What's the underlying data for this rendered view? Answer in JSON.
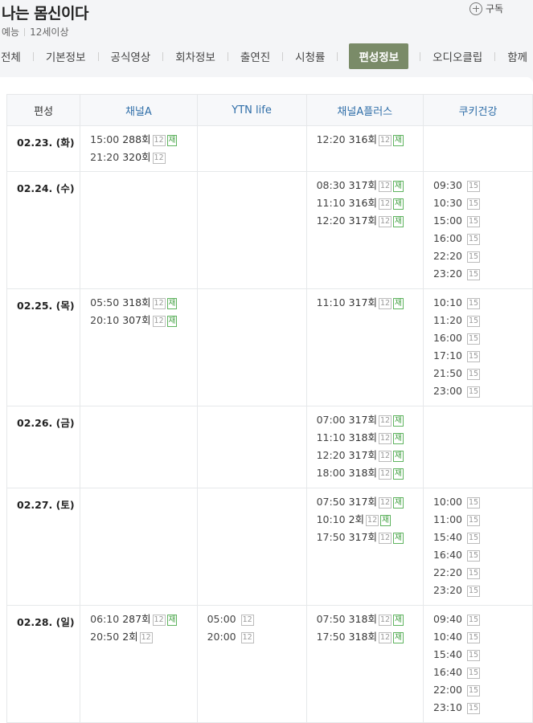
{
  "header": {
    "title": "나는 몸신이다",
    "genre": "예능",
    "rating": "12세이상",
    "subscribe_label": "구독"
  },
  "tabs": [
    {
      "label": "전체",
      "active": false
    },
    {
      "label": "기본정보",
      "active": false
    },
    {
      "label": "공식영상",
      "active": false
    },
    {
      "label": "회차정보",
      "active": false
    },
    {
      "label": "출연진",
      "active": false
    },
    {
      "label": "시청률",
      "active": false
    },
    {
      "label": "편성정보",
      "active": true
    },
    {
      "label": "오디오클립",
      "active": false
    },
    {
      "label": "함께",
      "active": false
    }
  ],
  "schedule": {
    "date_header": "편성",
    "channels": [
      "채널A",
      "YTN life",
      "채널A플러스",
      "쿠키건강"
    ],
    "rows": [
      {
        "date": "02.23. (화)",
        "cells": [
          [
            {
              "time": "15:00",
              "ep": "288회",
              "age": "12",
              "re": "재"
            },
            {
              "time": "21:20",
              "ep": "320회",
              "age": "12",
              "re": ""
            }
          ],
          [],
          [
            {
              "time": "12:20",
              "ep": "316회",
              "age": "12",
              "re": "재"
            }
          ],
          []
        ]
      },
      {
        "date": "02.24. (수)",
        "cells": [
          [],
          [],
          [
            {
              "time": "08:30",
              "ep": "317회",
              "age": "12",
              "re": "재"
            },
            {
              "time": "11:10",
              "ep": "316회",
              "age": "12",
              "re": "재"
            },
            {
              "time": "12:20",
              "ep": "317회",
              "age": "12",
              "re": "재"
            }
          ],
          [
            {
              "time": "09:30",
              "ep": "",
              "age": "15",
              "re": ""
            },
            {
              "time": "10:30",
              "ep": "",
              "age": "15",
              "re": ""
            },
            {
              "time": "15:00",
              "ep": "",
              "age": "15",
              "re": ""
            },
            {
              "time": "16:00",
              "ep": "",
              "age": "15",
              "re": ""
            },
            {
              "time": "22:20",
              "ep": "",
              "age": "15",
              "re": ""
            },
            {
              "time": "23:20",
              "ep": "",
              "age": "15",
              "re": ""
            }
          ]
        ]
      },
      {
        "date": "02.25. (목)",
        "cells": [
          [
            {
              "time": "05:50",
              "ep": "318회",
              "age": "12",
              "re": "재"
            },
            {
              "time": "20:10",
              "ep": "307회",
              "age": "12",
              "re": "재"
            }
          ],
          [],
          [
            {
              "time": "11:10",
              "ep": "317회",
              "age": "12",
              "re": "재"
            }
          ],
          [
            {
              "time": "10:10",
              "ep": "",
              "age": "15",
              "re": ""
            },
            {
              "time": "11:20",
              "ep": "",
              "age": "15",
              "re": ""
            },
            {
              "time": "16:00",
              "ep": "",
              "age": "15",
              "re": ""
            },
            {
              "time": "17:10",
              "ep": "",
              "age": "15",
              "re": ""
            },
            {
              "time": "21:50",
              "ep": "",
              "age": "15",
              "re": ""
            },
            {
              "time": "23:00",
              "ep": "",
              "age": "15",
              "re": ""
            }
          ]
        ]
      },
      {
        "date": "02.26. (금)",
        "cells": [
          [],
          [],
          [
            {
              "time": "07:00",
              "ep": "317회",
              "age": "12",
              "re": "재"
            },
            {
              "time": "11:10",
              "ep": "318회",
              "age": "12",
              "re": "재"
            },
            {
              "time": "12:20",
              "ep": "317회",
              "age": "12",
              "re": "재"
            },
            {
              "time": "18:00",
              "ep": "318회",
              "age": "12",
              "re": "재"
            }
          ],
          []
        ]
      },
      {
        "date": "02.27. (토)",
        "cells": [
          [],
          [],
          [
            {
              "time": "07:50",
              "ep": "317회",
              "age": "12",
              "re": "재"
            },
            {
              "time": "10:10",
              "ep": "2회",
              "age": "12",
              "re": "재"
            },
            {
              "time": "17:50",
              "ep": "317회",
              "age": "12",
              "re": "재"
            }
          ],
          [
            {
              "time": "10:00",
              "ep": "",
              "age": "15",
              "re": ""
            },
            {
              "time": "11:00",
              "ep": "",
              "age": "15",
              "re": ""
            },
            {
              "time": "15:40",
              "ep": "",
              "age": "15",
              "re": ""
            },
            {
              "time": "16:40",
              "ep": "",
              "age": "15",
              "re": ""
            },
            {
              "time": "22:20",
              "ep": "",
              "age": "15",
              "re": ""
            },
            {
              "time": "23:20",
              "ep": "",
              "age": "15",
              "re": ""
            }
          ]
        ]
      },
      {
        "date": "02.28. (일)",
        "cells": [
          [
            {
              "time": "06:10",
              "ep": "287회",
              "age": "12",
              "re": "재"
            },
            {
              "time": "20:50",
              "ep": "2회",
              "age": "12",
              "re": ""
            }
          ],
          [
            {
              "time": "05:00",
              "ep": "",
              "age": "12",
              "re": ""
            },
            {
              "time": "20:00",
              "ep": "",
              "age": "12",
              "re": ""
            }
          ],
          [
            {
              "time": "07:50",
              "ep": "318회",
              "age": "12",
              "re": "재"
            },
            {
              "time": "17:50",
              "ep": "318회",
              "age": "12",
              "re": "재"
            }
          ],
          [
            {
              "time": "09:40",
              "ep": "",
              "age": "15",
              "re": ""
            },
            {
              "time": "10:40",
              "ep": "",
              "age": "15",
              "re": ""
            },
            {
              "time": "15:40",
              "ep": "",
              "age": "15",
              "re": ""
            },
            {
              "time": "16:40",
              "ep": "",
              "age": "15",
              "re": ""
            },
            {
              "time": "22:00",
              "ep": "",
              "age": "15",
              "re": ""
            },
            {
              "time": "23:10",
              "ep": "",
              "age": "15",
              "re": ""
            }
          ]
        ]
      }
    ]
  }
}
